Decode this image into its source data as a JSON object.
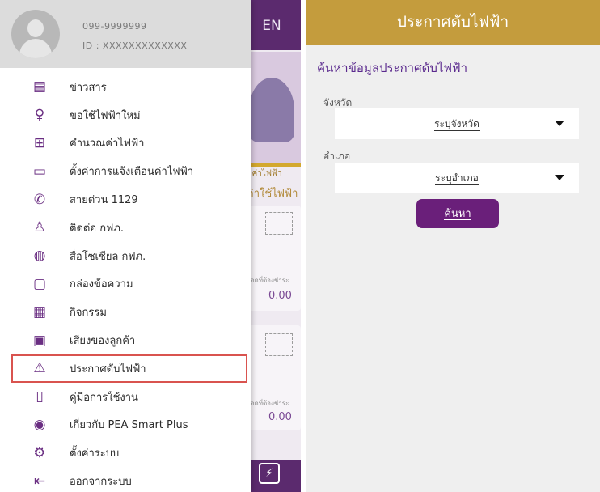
{
  "left": {
    "background": {
      "lang_button": "EN",
      "banner_small_text": "ดูค่าไฟฟ้า",
      "banner_big_text": "ค่าใช้ไฟฟ้า",
      "card1_label": "ยอดที่ต้องชำระ",
      "card1_amount": "0.00",
      "card2_label": "ยอดที่ต้องชำระ",
      "card2_amount": "0.00"
    },
    "profile": {
      "phone": "099-9999999",
      "id": "ID : XXXXXXXXXXXXX"
    },
    "menu": [
      {
        "label": "ข่าวสาร",
        "icon": "news-icon",
        "glyph": "▤"
      },
      {
        "label": "ขอใช้ไฟฟ้าใหม่",
        "icon": "lightbulb-icon",
        "glyph": "♀"
      },
      {
        "label": "คำนวณค่าไฟฟ้า",
        "icon": "calculator-icon",
        "glyph": "⊞"
      },
      {
        "label": "ตั้งค่าการแจ้งเตือนค่าไฟฟ้า",
        "icon": "battery-icon",
        "glyph": "▭"
      },
      {
        "label": "สายด่วน 1129",
        "icon": "phone-icon",
        "glyph": "✆"
      },
      {
        "label": "ติดต่อ กฟภ.",
        "icon": "contact-icon",
        "glyph": "♙"
      },
      {
        "label": "สื่อโซเชียล กฟภ.",
        "icon": "globe-icon",
        "glyph": "◍"
      },
      {
        "label": "กล่องข้อความ",
        "icon": "message-icon",
        "glyph": "▢"
      },
      {
        "label": "กิจกรรม",
        "icon": "calendar-icon",
        "glyph": "▦"
      },
      {
        "label": "เสียงของลูกค้า",
        "icon": "chat-icon",
        "glyph": "▣"
      },
      {
        "label": "ประกาศดับไฟฟ้า",
        "icon": "warning-bolt-icon",
        "glyph": "⚠"
      },
      {
        "label": "คู่มือการใช้งาน",
        "icon": "manual-icon",
        "glyph": "▯"
      },
      {
        "label": "เกี่ยวกับ PEA Smart Plus",
        "icon": "pea-logo-icon",
        "glyph": "◉"
      },
      {
        "label": "ตั้งค่าระบบ",
        "icon": "gear-icon",
        "glyph": "⚙"
      },
      {
        "label": "ออกจากระบบ",
        "icon": "logout-icon",
        "glyph": "⇤"
      }
    ],
    "active_index": 10,
    "highlight_color": "#d9534f",
    "accent_color": "#6a2e82"
  },
  "right": {
    "header_title": "ประกาศดับไฟฟ้า",
    "section_title": "ค้นหาข้อมูลประกาศดับไฟฟ้า",
    "province_label": "จังหวัด",
    "province_value": "ระบุจังหวัด",
    "district_label": "อำเภอ",
    "district_value": "ระบุอำเภอ",
    "search_button": "ค้นหา",
    "header_color": "#c49c3d",
    "button_color": "#6a1f7a"
  }
}
